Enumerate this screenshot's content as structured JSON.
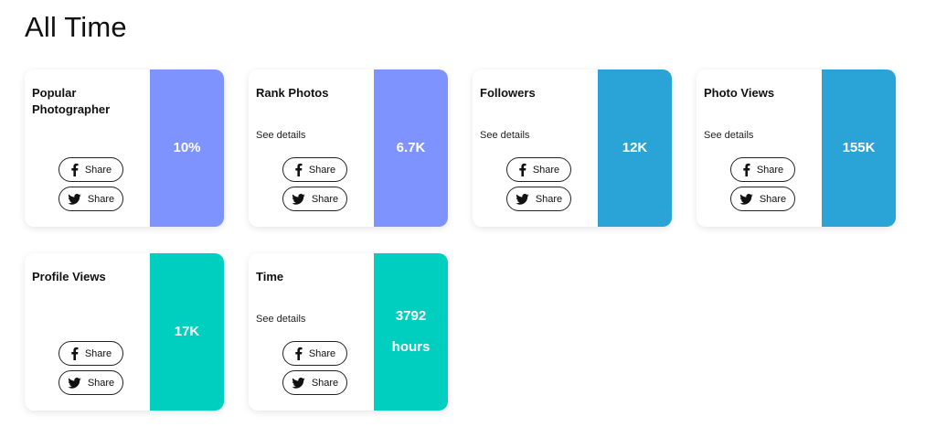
{
  "page": {
    "title": "All Time"
  },
  "share_label": "Share",
  "colors": {
    "purple": "#7f93ff",
    "blue": "#2aa3d6",
    "teal": "#00cfc0"
  },
  "cards": [
    {
      "title": "Popular Photographer",
      "details": "",
      "value": "10%",
      "value_line2": "",
      "color": "#7f93ff",
      "share_facebook": "Share",
      "share_twitter": "Share"
    },
    {
      "title": "Rank Photos",
      "details": "See details",
      "value": "6.7K",
      "value_line2": "",
      "color": "#7f93ff",
      "share_facebook": "Share",
      "share_twitter": "Share"
    },
    {
      "title": "Followers",
      "details": "See details",
      "value": "12K",
      "value_line2": "",
      "color": "#2aa3d6",
      "share_facebook": "Share",
      "share_twitter": "Share"
    },
    {
      "title": "Photo Views",
      "details": "See details",
      "value": "155K",
      "value_line2": "",
      "color": "#2aa3d6",
      "share_facebook": "Share",
      "share_twitter": "Share"
    },
    {
      "title": "Profile Views",
      "details": "",
      "value": "17K",
      "value_line2": "",
      "color": "#00cfc0",
      "share_facebook": "Share",
      "share_twitter": "Share"
    },
    {
      "title": "Time",
      "details": "See details",
      "value": "3792",
      "value_line2": "hours",
      "color": "#00cfc0",
      "share_facebook": "Share",
      "share_twitter": "Share"
    }
  ],
  "icons": {
    "facebook": "facebook-icon",
    "twitter": "twitter-icon"
  }
}
